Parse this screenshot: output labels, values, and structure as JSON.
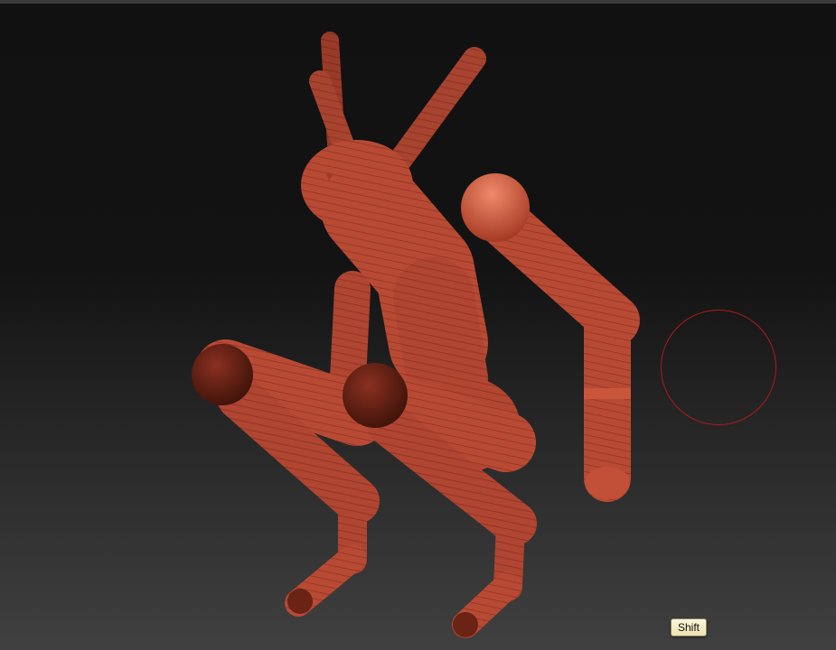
{
  "viewport": {
    "background_top": "#111111",
    "background_bottom": "#404040",
    "model_color": "#b84a34",
    "model_shadow_color": "#5a1d12",
    "model_highlight_color": "#e0745a",
    "brush_cursor_color": "#b11a1a"
  },
  "tooltip": {
    "label": "Shift"
  }
}
